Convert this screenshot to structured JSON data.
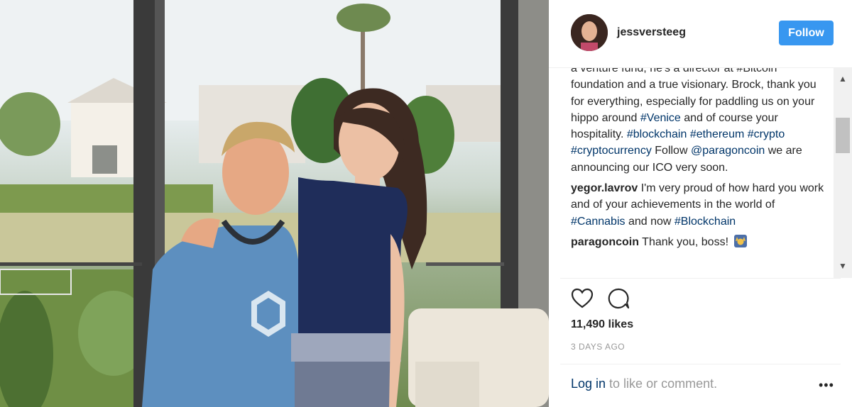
{
  "post": {
    "username": "jessversteeg",
    "follow_label": "Follow"
  },
  "caption": {
    "partial_top": "a venture fund, he's a director at #Bitcoin",
    "text_1": "foundation and a true visionary. Brock, thank you for everything, especially for paddling us on your hippo around",
    "tag_venice": "#Venice",
    "text_2": " and of course your hospitality.",
    "tag_blockchain": "#blockchain",
    "tag_ethereum": "#ethereum",
    "tag_crypto": "#crypto",
    "tag_cryptocurrency": "#cryptocurrency",
    "text_3": " Follow ",
    "mention_paragon": "@paragoncoin",
    "text_4": " we are announcing our ICO very soon."
  },
  "comments": [
    {
      "user": "yegor.lavrov",
      "text_1": " I'm very proud of how hard you work and of your achievements in the world of ",
      "tag_1": "#Cannabis",
      "text_2": " and now ",
      "tag_2": "#Blockchain"
    },
    {
      "user": "paragoncoin",
      "text_1": " Thank you, boss!"
    }
  ],
  "stats": {
    "likes": "11,490 likes",
    "date": "3 DAYS AGO"
  },
  "footer": {
    "login_label": "Log in",
    "login_suffix": " to like or comment.",
    "more_label": "•••"
  },
  "icons": {
    "like": "heart-icon",
    "comment": "speech-bubble-icon",
    "more": "more-options-icon",
    "emoji": "raising-hands-emoji"
  },
  "colors": {
    "follow_button": "#3897f0",
    "link": "#003569",
    "muted": "#999999"
  }
}
